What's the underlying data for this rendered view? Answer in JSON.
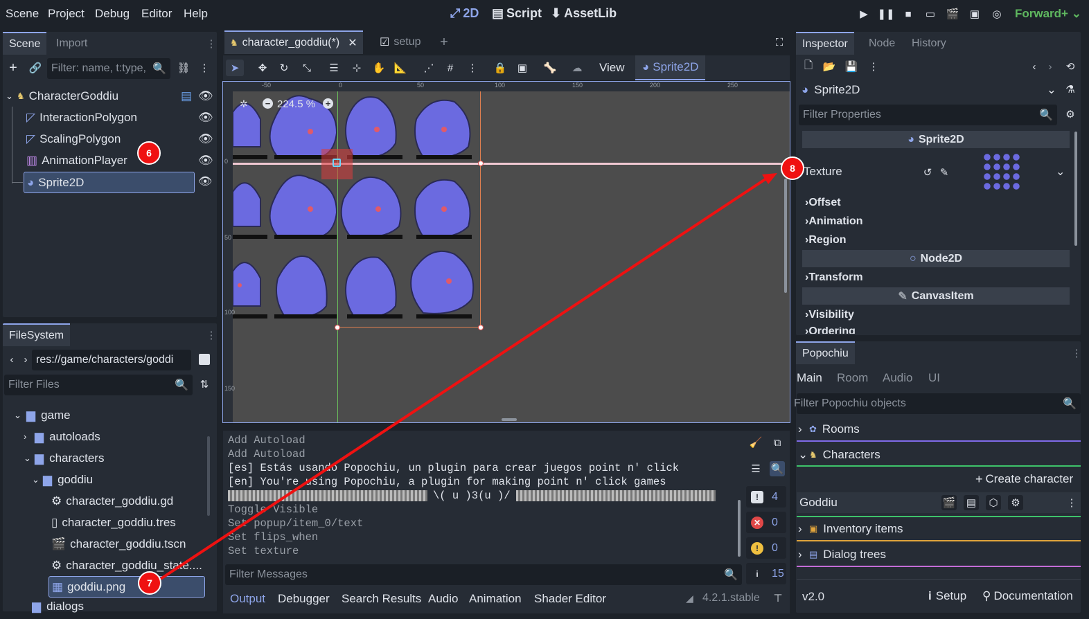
{
  "menu": {
    "scene": "Scene",
    "project": "Project",
    "debug": "Debug",
    "editor": "Editor",
    "help": "Help"
  },
  "workspaces": {
    "two_d": "2D",
    "script": "Script",
    "assetlib": "AssetLib"
  },
  "renderer": "Forward+",
  "scene_dock": {
    "tabs": [
      "Scene",
      "Import"
    ],
    "filter_placeholder": "Filter: name, t:type,",
    "nodes": [
      "CharacterGoddiu",
      "InteractionPolygon",
      "ScalingPolygon",
      "AnimationPlayer",
      "Sprite2D"
    ]
  },
  "filesystem": {
    "tab": "FileSystem",
    "path": "res://game/characters/goddi",
    "filter_placeholder": "Filter Files",
    "items": [
      "game",
      "autoloads",
      "characters",
      "goddiu",
      "character_goddiu.gd",
      "character_goddiu.tres",
      "character_goddiu.tscn",
      "character_goddiu_state....",
      "goddiu.png",
      "dialogs"
    ]
  },
  "editor_tabs": {
    "scene_tab": "character_goddiu(*)",
    "setup_tab": "setup"
  },
  "toolbar": {
    "view": "View",
    "sprite_label": "Sprite2D"
  },
  "viewport": {
    "zoom": "224.5 %",
    "ruler_top": [
      "-50",
      "0",
      "50",
      "100",
      "150",
      "200",
      "250"
    ],
    "ruler_left": [
      "0",
      "50",
      "100",
      "150"
    ]
  },
  "output": {
    "lines": [
      "Add Autoload",
      "Add Autoload",
      "[es] Estás usando Popochiu, un plugin para crear juegos point n' click",
      "[en] You're using Popochiu, a plugin for making point n' click games",
      "\\( u )3(u )/",
      "Toggle Visible",
      "Set popup/item_0/text",
      "Set flips_when",
      "Set texture"
    ],
    "filter_placeholder": "Filter Messages",
    "counts": {
      "messages": "4",
      "errors": "0",
      "warnings": "0",
      "info": "15"
    }
  },
  "bottom_tabs": [
    "Output",
    "Debugger",
    "Search Results",
    "Audio",
    "Animation",
    "Shader Editor"
  ],
  "version": "4.2.1.stable",
  "inspector": {
    "tabs": [
      "Inspector",
      "Node",
      "History"
    ],
    "object": "Sprite2D",
    "filter_placeholder": "Filter Properties",
    "section_sprite": "Sprite2D",
    "texture_label": "Texture",
    "groups": [
      "Offset",
      "Animation",
      "Region"
    ],
    "section_node2d": "Node2D",
    "transform": "Transform",
    "section_canvas": "CanvasItem",
    "visibility": "Visibility",
    "ordering": "Ordering"
  },
  "popochiu": {
    "title": "Popochiu",
    "tabs": [
      "Main",
      "Room",
      "Audio",
      "UI"
    ],
    "filter_placeholder": "Filter Popochiu objects",
    "rooms": "Rooms",
    "characters": "Characters",
    "create_character": "Create character",
    "character_name": "Goddiu",
    "inventory": "Inventory items",
    "dialogs": "Dialog trees",
    "version": "v2.0",
    "setup": "Setup",
    "docs": "Documentation"
  },
  "annotations": [
    "6",
    "7",
    "8"
  ],
  "colors": {
    "accent": "#8ea5e9",
    "badge": "#ef1111",
    "arrow": "#ef1111",
    "rooms_line": "#7f6ae8",
    "characters_line": "#3ec36a",
    "inventory_line": "#e0a43c",
    "dialogs_line": "#c46cd6"
  }
}
